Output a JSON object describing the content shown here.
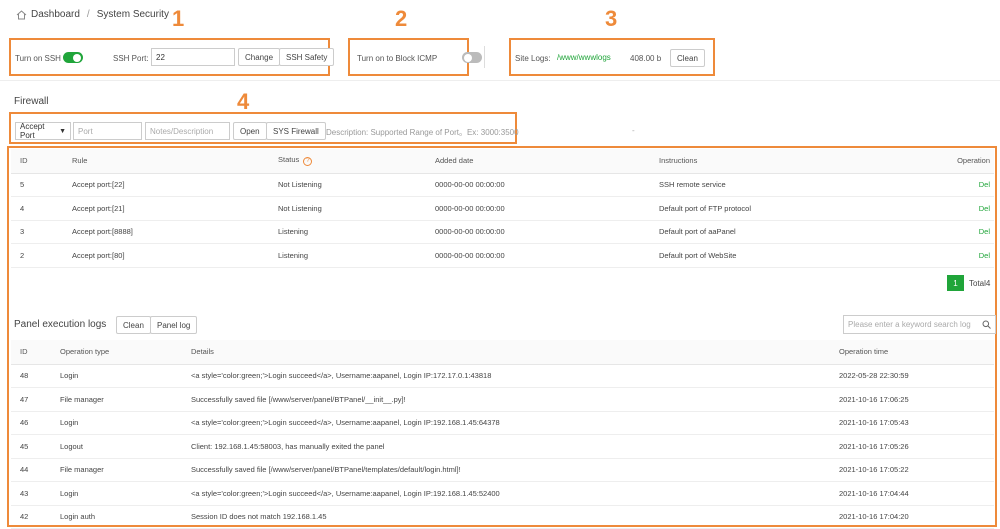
{
  "breadcrumb": {
    "home": "Dashboard",
    "separator": "/",
    "current": "System Security"
  },
  "markers": [
    "1",
    "2",
    "3",
    "4"
  ],
  "ssh": {
    "toggle_label": "Turn on SSH",
    "enabled": true,
    "port_label": "SSH Port:",
    "port_value": "22",
    "change_label": "Change",
    "safety_label": "SSH Safety"
  },
  "icmp": {
    "toggle_label": "Turn on to Block ICMP",
    "enabled": false
  },
  "site_logs": {
    "label": "Site Logs:",
    "path": "/www/wwwlogs",
    "size": "408.00 b",
    "clean_label": "Clean"
  },
  "firewall": {
    "title": "Firewall",
    "select_value": "Accept Port",
    "port_placeholder": "Port",
    "notes_placeholder": "Notes/Description",
    "open_label": "Open",
    "sys_label": "SYS Firewall",
    "description": "Description: Supported Range of Port。Ex: 3000:3500",
    "dash": "-",
    "columns": [
      "ID",
      "Rule",
      "Status",
      "Added date",
      "Instructions",
      "Operation"
    ],
    "rows": [
      {
        "id": "5",
        "rule": "Accept port:[22]",
        "status": "Not Listening",
        "date": "0000-00-00 00:00:00",
        "instr": "SSH remote service",
        "op": "Del"
      },
      {
        "id": "4",
        "rule": "Accept port:[21]",
        "status": "Not Listening",
        "date": "0000-00-00 00:00:00",
        "instr": "Default port of FTP protocol",
        "op": "Del"
      },
      {
        "id": "3",
        "rule": "Accept port:[8888]",
        "status": "Listening",
        "date": "0000-00-00 00:00:00",
        "instr": "Default port of aaPanel",
        "op": "Del"
      },
      {
        "id": "2",
        "rule": "Accept port:[80]",
        "status": "Listening",
        "date": "0000-00-00 00:00:00",
        "instr": "Default port of WebSite",
        "op": "Del"
      }
    ],
    "page": "1",
    "total": "Total4"
  },
  "logs": {
    "title": "Panel execution logs",
    "clean_label": "Clean",
    "panel_log_label": "Panel log",
    "search_placeholder": "Please enter a keyword search log",
    "columns": [
      "ID",
      "Operation type",
      "Details",
      "Operation time"
    ],
    "rows": [
      {
        "id": "48",
        "type": "Login",
        "details": "<a style='color:green;'>Login succeed</a>, Username:aapanel, Login IP:172.17.0.1:43818",
        "time": "2022-05-28 22:30:59"
      },
      {
        "id": "47",
        "type": "File manager",
        "details": "Successfully saved file [/www/server/panel/BTPanel/__init__.py]!",
        "time": "2021-10-16 17:06:25"
      },
      {
        "id": "46",
        "type": "Login",
        "details": "<a style='color:green;'>Login succeed</a>, Username:aapanel, Login IP:192.168.1.45:64378",
        "time": "2021-10-16 17:05:43"
      },
      {
        "id": "45",
        "type": "Logout",
        "details": "Client: 192.168.1.45:58003, has manually exited the panel",
        "time": "2021-10-16 17:05:26"
      },
      {
        "id": "44",
        "type": "File manager",
        "details": "Successfully saved file [/www/server/panel/BTPanel/templates/default/login.html]!",
        "time": "2021-10-16 17:05:22"
      },
      {
        "id": "43",
        "type": "Login",
        "details": "<a style='color:green;'>Login succeed</a>, Username:aapanel, Login IP:192.168.1.45:52400",
        "time": "2021-10-16 17:04:44"
      },
      {
        "id": "42",
        "type": "Login auth",
        "details": "Session ID does not match 192.168.1.45",
        "time": "2021-10-16 17:04:20"
      }
    ]
  },
  "colors": {
    "accent": "#20a53a",
    "annotation": "#ee8a3a"
  }
}
